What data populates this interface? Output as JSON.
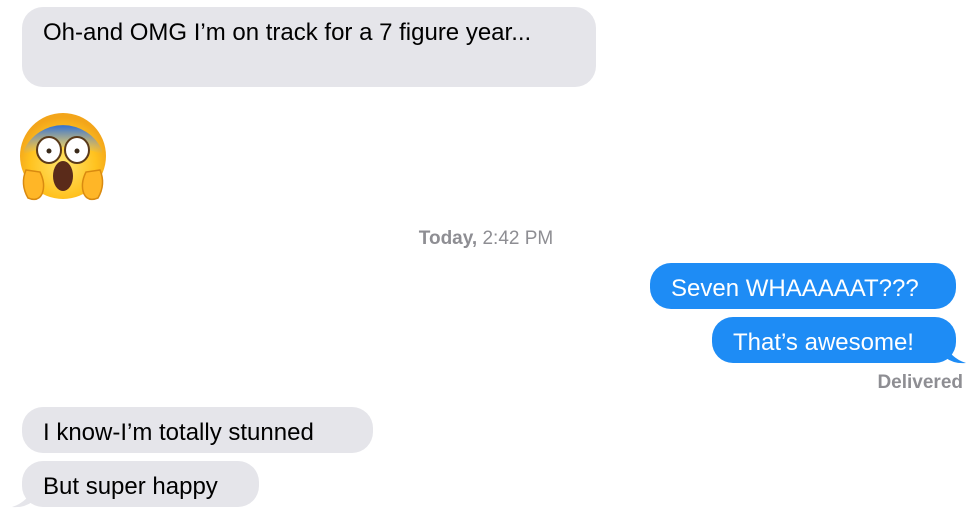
{
  "messages": {
    "m1": "Oh-and OMG  I’m on track for a 7 figure year...",
    "m2_emoji": "screaming-face-emoji",
    "m3": "Seven WHAAAAAT???",
    "m4": "That’s awesome!",
    "m5": "I know-I’m totally stunned",
    "m6": "But super happy"
  },
  "timestamp": {
    "day": "Today,",
    "time": "2:42 PM"
  },
  "status": "Delivered",
  "colors": {
    "incoming_bubble": "#e5e5ea",
    "outgoing_bubble": "#1e8cf5",
    "meta_text": "#8e8e93"
  }
}
